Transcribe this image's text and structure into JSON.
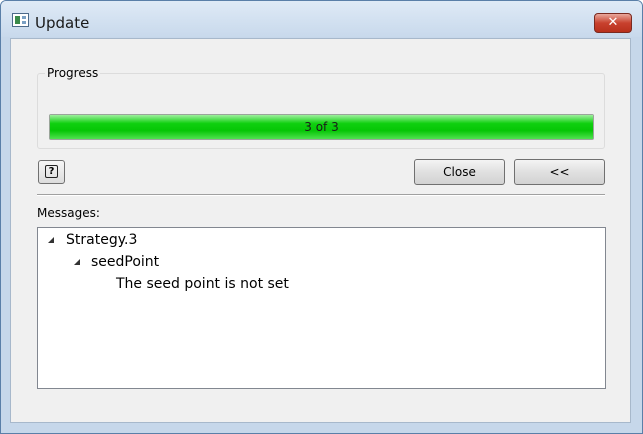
{
  "window": {
    "title": "Update",
    "close_glyph": "✕",
    "icon": "app-window-icon"
  },
  "progress": {
    "label": "Progress",
    "value": 3,
    "max": 3,
    "text": "3 of 3",
    "color": "#10d010"
  },
  "buttons": {
    "help_glyph": "?",
    "close_label": "Close",
    "collapse_label": "<<"
  },
  "messages": {
    "label": "Messages:",
    "tree": [
      {
        "label": "Strategy.3",
        "level": 0,
        "expanded": true
      },
      {
        "label": "seedPoint",
        "level": 1,
        "expanded": true
      },
      {
        "label": "The seed point is not set",
        "level": 2
      }
    ]
  }
}
